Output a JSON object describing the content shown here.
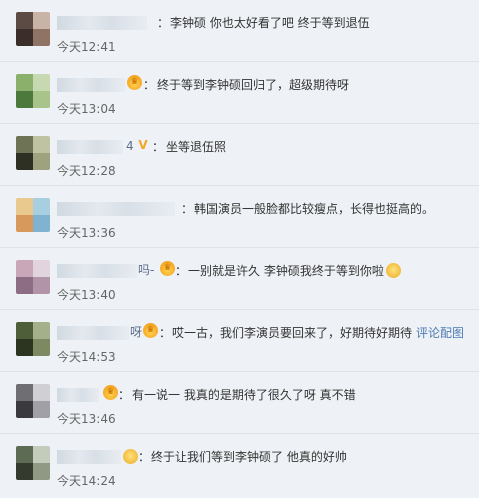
{
  "comments": [
    {
      "name_suffix": "",
      "badge": "",
      "text": "李钟硕 你也太好看了吧 终于等到退伍",
      "time": "今天12:41",
      "avatar": [
        "#5c4a44",
        "#c9b3a6",
        "#3b2e2a",
        "#8f7466"
      ]
    },
    {
      "name_suffix": "",
      "badge": "crown",
      "text": "终于等到李钟硕回归了，超级期待呀",
      "time": "今天13:04",
      "avatar": [
        "#8bb06b",
        "#c6d9b0",
        "#4d7a3c",
        "#a8c48a"
      ]
    },
    {
      "name_suffix": "4",
      "badge": "vip",
      "text": "坐等退伍照",
      "time": "今天12:28",
      "avatar": [
        "#6e7355",
        "#c0c3a2",
        "#2f3024",
        "#9ea27e"
      ]
    },
    {
      "name_suffix": "",
      "badge": "",
      "text": "韩国演员一般脸都比较瘦点，长得也挺高的。",
      "time": "今天13:36",
      "avatar": [
        "#e9c98d",
        "#a7cfe0",
        "#d89a5c",
        "#7fb3cf"
      ]
    },
    {
      "name_suffix": "吗-",
      "badge": "crown",
      "text": "一别就是许久 李钟硕我终于等到你啦",
      "time": "今天13:40",
      "avatar": [
        "#c9a7b9",
        "#e2d4df",
        "#8c6d84",
        "#b294a8"
      ]
    },
    {
      "name_suffix": "呀",
      "badge": "crown",
      "text": "哎一古，我们李演员要回来了，好期待好期待",
      "link": "评论配图",
      "time": "今天14:53",
      "avatar": [
        "#4d5e38",
        "#a4b089",
        "#2c3520",
        "#7d8a61"
      ]
    },
    {
      "name_suffix": "",
      "badge": "crown",
      "text": "有一说一 我真的是期待了很久了呀 真不错",
      "time": "今天13:46",
      "avatar": [
        "#6e6e73",
        "#d0d0d4",
        "#3a3a3e",
        "#a0a0a6"
      ]
    },
    {
      "name_suffix": "",
      "badge": "emoji",
      "text": "终于让我们等到李钟硕了 他真的好帅",
      "time": "今天14:24",
      "avatar": [
        "#5d6a54",
        "#c3cbbb",
        "#343b2e",
        "#8e9a84"
      ]
    }
  ],
  "colors": {
    "link": "#4e7cb5",
    "name": "#5b6f8c",
    "background": "#eef1f5"
  }
}
